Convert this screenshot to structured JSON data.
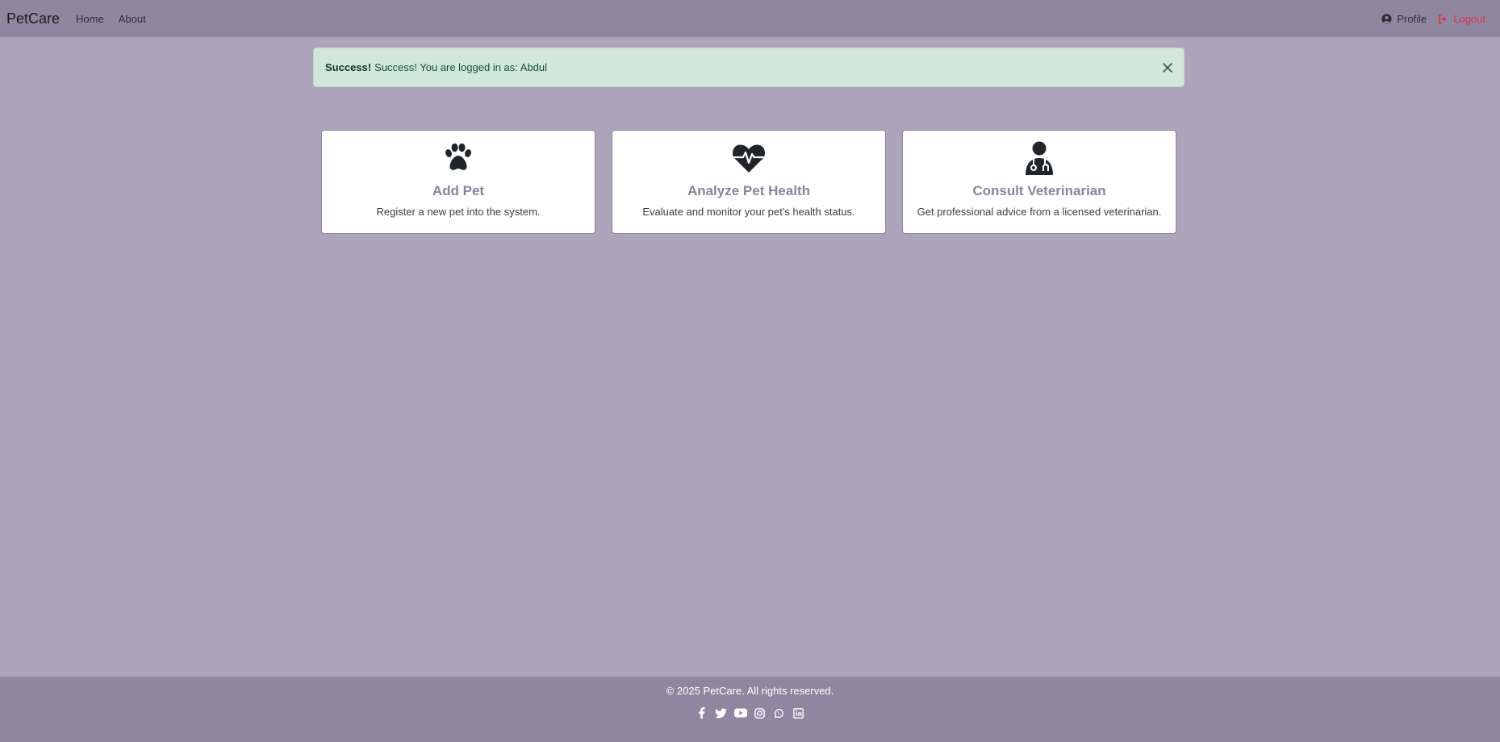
{
  "navbar": {
    "brand": "PetCare",
    "links": [
      {
        "label": "Home"
      },
      {
        "label": "About"
      }
    ],
    "profile_label": "Profile",
    "logout_label": "Logout"
  },
  "alert": {
    "strong": "Success!",
    "message": "Success! You are logged in as: Abdul"
  },
  "cards": [
    {
      "icon": "paw-icon",
      "title": "Add Pet",
      "description": "Register a new pet into the system."
    },
    {
      "icon": "heart-pulse-icon",
      "title": "Analyze Pet Health",
      "description": "Evaluate and monitor your pet's health status."
    },
    {
      "icon": "user-doctor-icon",
      "title": "Consult Veterinarian",
      "description": "Get professional advice from a licensed veterinarian."
    }
  ],
  "footer": {
    "copyright": "© 2025 PetCare. All rights reserved.",
    "social_icons": [
      "facebook-icon",
      "twitter-icon",
      "youtube-icon",
      "instagram-icon",
      "whatsapp-icon",
      "linkedin-icon"
    ]
  },
  "colors": {
    "navbar": "#8f879f",
    "background": "#aca4bb",
    "alert_bg": "#d1e7dd",
    "card_title": "#8a83a0",
    "logout": "#dc3545"
  }
}
